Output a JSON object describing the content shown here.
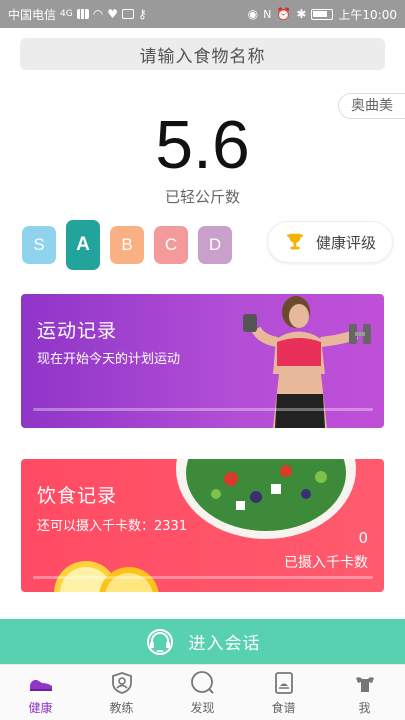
{
  "status_bar": {
    "carrier": "中国电信",
    "network": "4G",
    "time": "上午10:00"
  },
  "search": {
    "placeholder": "请输入食物名称"
  },
  "brand_chip": "奥曲美",
  "weight": {
    "value": "5.6",
    "label": "已轻公斤数"
  },
  "grades": [
    {
      "label": "S",
      "color": "#8fd3ef",
      "active": false
    },
    {
      "label": "A",
      "color": "#22a39b",
      "active": true
    },
    {
      "label": "B",
      "color": "#f9b184",
      "active": false
    },
    {
      "label": "C",
      "color": "#f59a9a",
      "active": false
    },
    {
      "label": "D",
      "color": "#c9a0cc",
      "active": false
    }
  ],
  "rating_button": {
    "label": "健康评级",
    "icon": "trophy-icon"
  },
  "exercise_card": {
    "title": "运动记录",
    "subtitle": "现在开始今天的计划运动",
    "progress": 0
  },
  "diet_card": {
    "title": "饮食记录",
    "remaining": "还可以摄入千卡数：2331",
    "consumed_value": "0",
    "consumed_label": "已摄入千卡数",
    "progress": 0
  },
  "enter_chat": {
    "label": "进入会话",
    "icon": "headset-icon"
  },
  "tabs": [
    {
      "label": "健康",
      "icon": "sneaker-icon",
      "active": true
    },
    {
      "label": "教练",
      "icon": "coach-shield-icon",
      "active": false
    },
    {
      "label": "发现",
      "icon": "discover-icon",
      "active": false
    },
    {
      "label": "食谱",
      "icon": "recipe-book-icon",
      "active": false
    },
    {
      "label": "我",
      "icon": "fitness-person-icon",
      "active": false
    }
  ],
  "colors": {
    "accent_purple": "#8f35c8",
    "accent_teal": "#58d1b1",
    "diet_red": "#ff4b63"
  }
}
